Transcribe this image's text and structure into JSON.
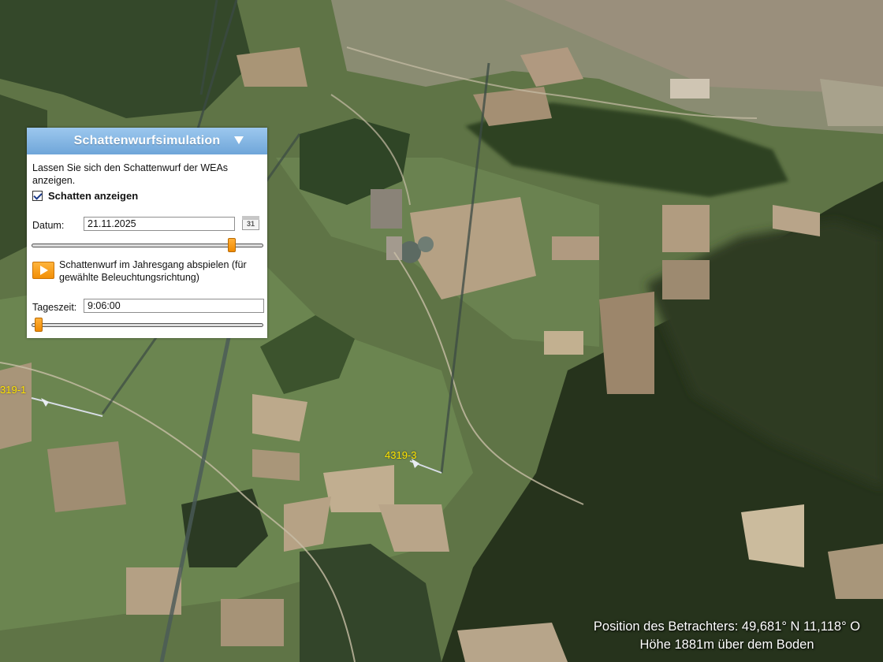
{
  "panel": {
    "title": "Schattenwurfsimulation",
    "description": "Lassen Sie sich den Schattenwurf der WEAs anzeigen.",
    "show_shadow_checkbox": {
      "label": "Schatten anzeigen",
      "checked": true
    },
    "datum": {
      "label": "Datum:",
      "value": "21.11.2025",
      "calendar_icon_text": "31"
    },
    "datum_slider_fraction": 0.88,
    "play": {
      "label": "Schattenwurf im Jahresgang abspielen (für gewählte Beleuchtungsrichtung)"
    },
    "tageszeit": {
      "label": "Tageszeit:",
      "value": "9:06:00"
    },
    "tageszeit_slider_fraction": 0.01
  },
  "map": {
    "turbine_labels": [
      "319-1",
      "4319-3"
    ]
  },
  "status": {
    "position": "Position des Betrachters: 49,681° N 11,118° O",
    "hoehe": "Höhe 1881m über dem Boden"
  },
  "colors": {
    "header": "#7fb2e2",
    "accent": "#f59300",
    "label_yellow": "#ffe400"
  }
}
